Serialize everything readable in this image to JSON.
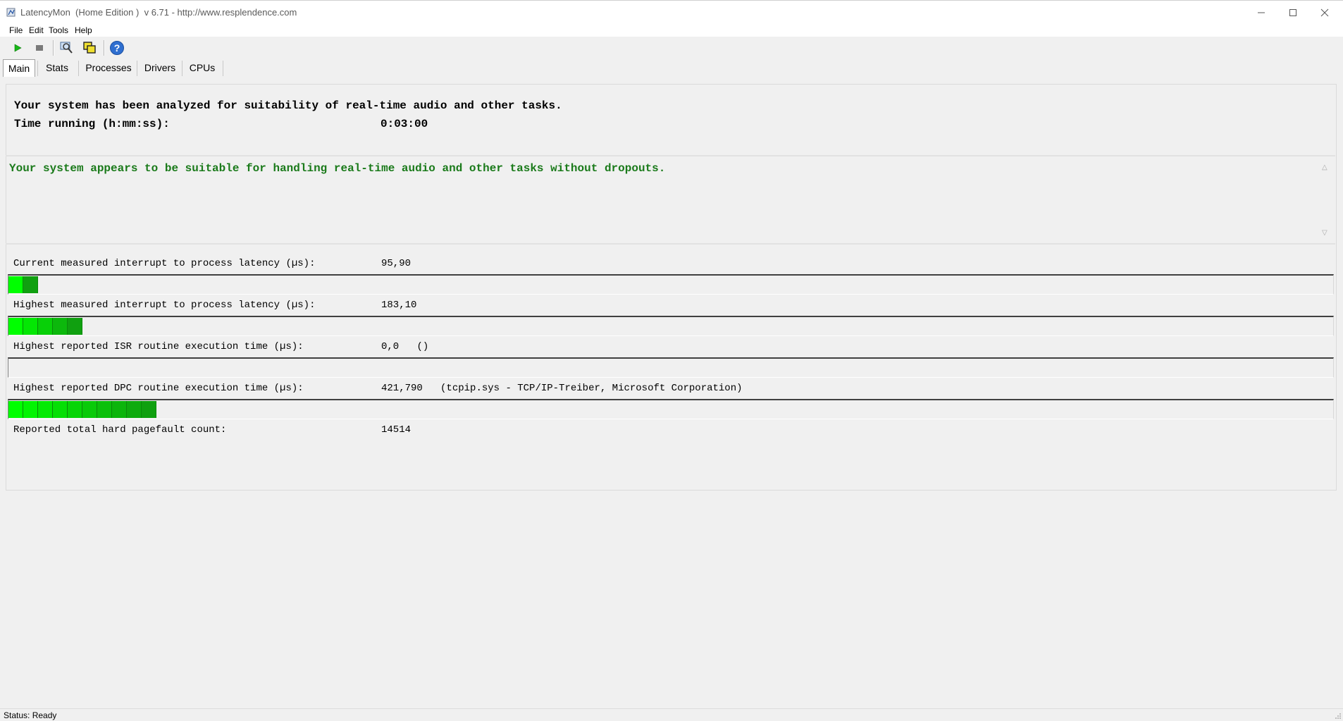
{
  "window": {
    "title": "LatencyMon  (Home Edition )  v 6.71 - http://www.resplendence.com"
  },
  "menu": {
    "items": [
      {
        "label": "File"
      },
      {
        "label": "Edit"
      },
      {
        "label": "Tools"
      },
      {
        "label": "Help"
      }
    ]
  },
  "toolbar": {
    "buttons": [
      {
        "icon": "play-icon"
      },
      {
        "icon": "stop-icon"
      },
      {
        "icon": "analyze-icon"
      },
      {
        "icon": "windows-icon"
      },
      {
        "icon": "help-icon"
      }
    ]
  },
  "tabs": [
    {
      "label": "Main",
      "active": true
    },
    {
      "label": "Stats"
    },
    {
      "label": "Processes"
    },
    {
      "label": "Drivers"
    },
    {
      "label": "CPUs"
    }
  ],
  "main": {
    "analysis_line": "Your system has been analyzed for suitability of real-time audio and other tasks.",
    "time_label": "Time running (h:mm:ss):",
    "time_value": "0:03:00",
    "verdict": "Your system appears to be suitable for handling real-time audio and other tasks without dropouts.",
    "metrics": [
      {
        "label": "Current measured interrupt to process latency (µs):",
        "value": "95,90",
        "detail": "",
        "bar_segments": 2
      },
      {
        "label": "Highest measured interrupt to process latency (µs):",
        "value": "183,10",
        "detail": "",
        "bar_segments": 5
      },
      {
        "label": "Highest reported ISR routine execution time (µs):",
        "value": "0,0",
        "detail": "()",
        "bar_segments": 0
      },
      {
        "label": "Highest reported DPC routine execution time (µs):",
        "value": "421,790",
        "detail": "(tcpip.sys - TCP/IP-Treiber, Microsoft Corporation)",
        "bar_segments": 10
      }
    ],
    "pagefault_label": "Reported total hard pagefault count:",
    "pagefault_value": "14514"
  },
  "status": {
    "text": "Status: Ready"
  },
  "colors": {
    "verdict_green": "#1a7a1a",
    "bar_green_light": "#00ff00",
    "bar_green_dark": "#10a010"
  }
}
